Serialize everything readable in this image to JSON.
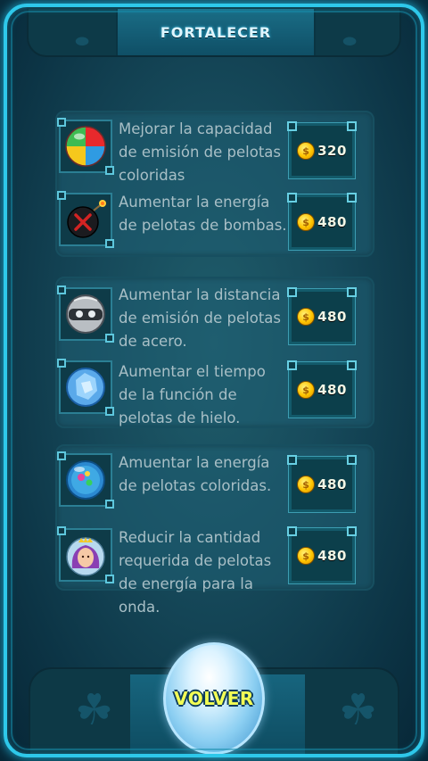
{
  "header": {
    "title": "FORTALECER"
  },
  "upgrades": [
    {
      "icon": "beach-ball-icon",
      "description": "Mejorar la capacidad de emisión de pelotas coloridas",
      "price": "320"
    },
    {
      "icon": "bomb-ball-icon",
      "description": "Aumentar la energía de pelotas de bombas.",
      "price": "480"
    },
    {
      "icon": "steel-ball-icon",
      "description": "Aumentar la distancia de emisión de pelotas de acero.",
      "price": "480"
    },
    {
      "icon": "ice-ball-icon",
      "description": "Aumentar el tiempo de la función de pelotas de hielo.",
      "price": "480"
    },
    {
      "icon": "color-bubble-icon",
      "description": "Amuentar la energía de pelotas coloridas.",
      "price": "480"
    },
    {
      "icon": "mermaid-avatar-icon",
      "description": "Reducir la cantidad requerida de pelotas de energía para la onda.",
      "price": "480"
    }
  ],
  "back_button": {
    "label": "VOLVER"
  }
}
